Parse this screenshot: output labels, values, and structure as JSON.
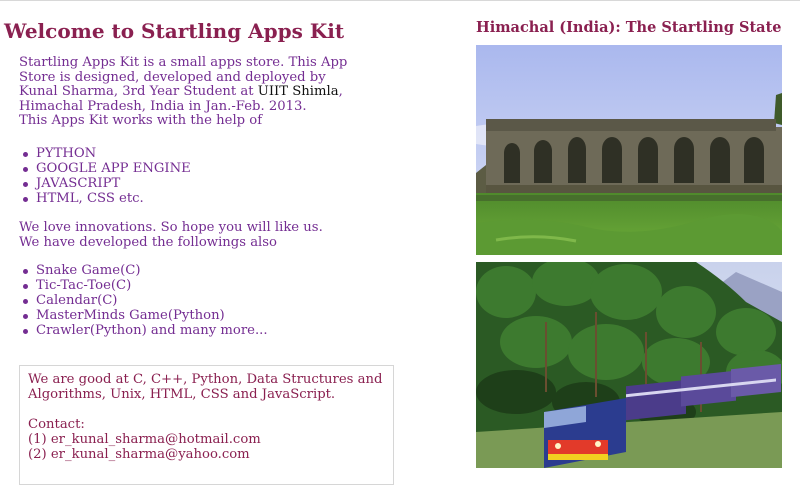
{
  "main": {
    "title": "Welcome to Startling Apps Kit",
    "intro_before_link": "Startling Apps Kit is a small apps store. This App Store is designed, developed and deployed by Kunal Sharma, 3rd Year Student at ",
    "intro_link": "UIIT Shimla",
    "intro_after_link": ", Himachal Pradesh, India in Jan.-Feb. 2013.",
    "intro_line2": "This Apps Kit works with the help of",
    "tech_list": [
      "PYTHON",
      "GOOGLE APP ENGINE",
      "JAVASCRIPT",
      "HTML, CSS etc."
    ],
    "para2_line1": "We love innovations. So hope you will like us.",
    "para2_line2": "We have developed the followings also",
    "apps_list": [
      "Snake Game(C)",
      "Tic-Tac-Toe(C)",
      "Calendar(C)",
      "MasterMinds Game(Python)",
      "Crawler(Python) and many more..."
    ]
  },
  "contact_box": {
    "skills": "We are good at C, C++, Python, Data Structures and Algorithms, Unix, HTML, CSS and JavaScript.",
    "contact_label": "Contact:",
    "email1": "(1) er_kunal_sharma@hotmail.com",
    "email2": "(2) er_kunal_sharma@yahoo.com"
  },
  "sidebar": {
    "title": "Himachal (India): The Startling State"
  },
  "colors": {
    "heading": "#8a2050",
    "body_text": "#742d92",
    "link": "#111111"
  }
}
